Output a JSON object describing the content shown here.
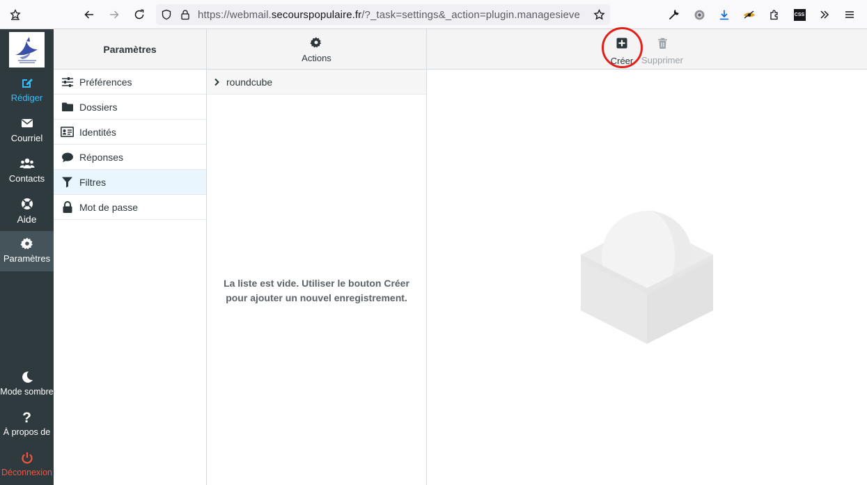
{
  "browser": {
    "url_prefix": "https://webmail.",
    "url_domain": "secourspopulaire.fr",
    "url_suffix": "/?_task=settings&_action=plugin.managesieve",
    "icons": [
      "bookmark-star-icon",
      "back-icon",
      "forward-icon",
      "reload-icon",
      "shield-icon",
      "lock-icon",
      "star-icon",
      "wrench-icon",
      "extension-badge-icon",
      "download-icon",
      "eye-extension-icon",
      "puzzle-icon",
      "css-icon",
      "overflow-icon",
      "menu-icon"
    ],
    "css_badge": "CSS"
  },
  "nav": {
    "logo_icon": "secours-populaire-logo",
    "items": [
      {
        "label": "Rédiger",
        "icon": "compose-icon"
      },
      {
        "label": "Courriel",
        "icon": "envelope-icon"
      },
      {
        "label": "Contacts",
        "icon": "users-icon"
      },
      {
        "label": "Aide",
        "icon": "lifebuoy-icon"
      },
      {
        "label": "Paramètres",
        "icon": "gear-icon"
      }
    ],
    "bottom": [
      {
        "label": "Mode sombre",
        "icon": "moon-icon"
      },
      {
        "label": "À propos de",
        "icon": "question-icon"
      },
      {
        "label": "Déconnexion",
        "icon": "power-icon"
      }
    ],
    "accent": "#37beff",
    "logout_color": "#f2563e"
  },
  "settings": {
    "title": "Paramètres",
    "items": [
      {
        "label": "Préférences",
        "icon": "sliders-icon"
      },
      {
        "label": "Dossiers",
        "icon": "folder-icon"
      },
      {
        "label": "Identités",
        "icon": "id-card-icon"
      },
      {
        "label": "Réponses",
        "icon": "comment-icon"
      },
      {
        "label": "Filtres",
        "icon": "filter-icon"
      },
      {
        "label": "Mot de passe",
        "icon": "lock-icon"
      }
    ],
    "selected": "Filtres"
  },
  "filters": {
    "actions_label": "Actions",
    "filterset": "roundcube",
    "empty_line1": "La liste est vide. Utiliser le bouton Créer",
    "empty_line2": "pour ajouter un nouvel enregistrement."
  },
  "toolbar": {
    "create_label": "Créer",
    "delete_label": "Supprimer",
    "highlight_color": "#e0201b"
  }
}
